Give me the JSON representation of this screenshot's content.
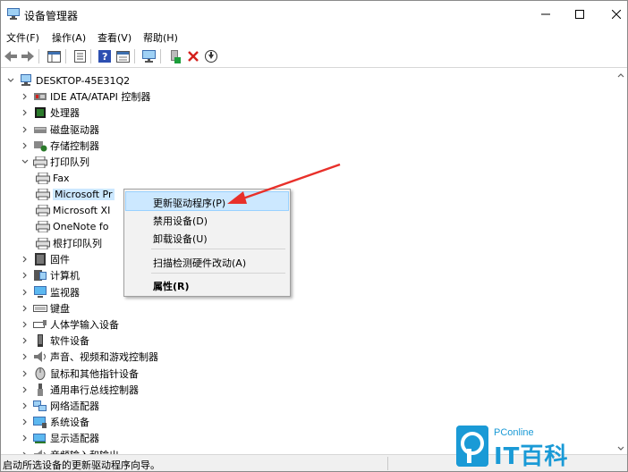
{
  "window": {
    "title": "设备管理器"
  },
  "menubar": {
    "items": [
      "文件(F)",
      "操作(A)",
      "查看(V)",
      "帮助(H)"
    ]
  },
  "tree": {
    "root": "DESKTOP-45E31Q2",
    "items": [
      {
        "label": "IDE ATA/ATAPI 控制器",
        "icon": "ide-controller-icon",
        "expanded": false
      },
      {
        "label": "处理器",
        "icon": "processor-icon",
        "expanded": false
      },
      {
        "label": "磁盘驱动器",
        "icon": "disk-drive-icon",
        "expanded": false
      },
      {
        "label": "存储控制器",
        "icon": "storage-controller-icon",
        "expanded": false
      },
      {
        "label": "打印队列",
        "icon": "printer-icon",
        "expanded": true
      },
      {
        "label": "Fax",
        "icon": "printer-icon",
        "child": true
      },
      {
        "label": "Microsoft Pr",
        "icon": "printer-icon",
        "child": true,
        "selected": true
      },
      {
        "label": "Microsoft XI",
        "icon": "printer-icon",
        "child": true
      },
      {
        "label": "OneNote fo",
        "icon": "printer-icon",
        "child": true
      },
      {
        "label": "根打印队列",
        "icon": "printer-icon",
        "child": true
      },
      {
        "label": "固件",
        "icon": "firmware-icon",
        "expanded": false
      },
      {
        "label": "计算机",
        "icon": "computer-icon",
        "expanded": false
      },
      {
        "label": "监视器",
        "icon": "monitor-icon",
        "expanded": false
      },
      {
        "label": "键盘",
        "icon": "keyboard-icon",
        "expanded": false
      },
      {
        "label": "人体学输入设备",
        "icon": "hid-icon",
        "expanded": false
      },
      {
        "label": "软件设备",
        "icon": "software-device-icon",
        "expanded": false
      },
      {
        "label": "声音、视频和游戏控制器",
        "icon": "sound-icon",
        "expanded": false
      },
      {
        "label": "鼠标和其他指针设备",
        "icon": "mouse-icon",
        "expanded": false
      },
      {
        "label": "通用串行总线控制器",
        "icon": "usb-icon",
        "expanded": false
      },
      {
        "label": "网络适配器",
        "icon": "network-adapter-icon",
        "expanded": false
      },
      {
        "label": "系统设备",
        "icon": "system-device-icon",
        "expanded": false
      },
      {
        "label": "显示适配器",
        "icon": "display-adapter-icon",
        "expanded": false
      },
      {
        "label": "音频输入和输出",
        "icon": "audio-icon",
        "expanded": false
      }
    ]
  },
  "context_menu": {
    "items": [
      "更新驱动程序(P)",
      "禁用设备(D)",
      "卸载设备(U)",
      "扫描检测硬件改动(A)",
      "属性(R)"
    ]
  },
  "status": {
    "text": "启动所选设备的更新驱动程序向导。"
  },
  "watermark": {
    "small": "PConline",
    "big": "IT百科"
  },
  "colors": {
    "accent": "#1a9ad6",
    "highlight": "#cce8ff",
    "arrow": "#e8302a"
  }
}
